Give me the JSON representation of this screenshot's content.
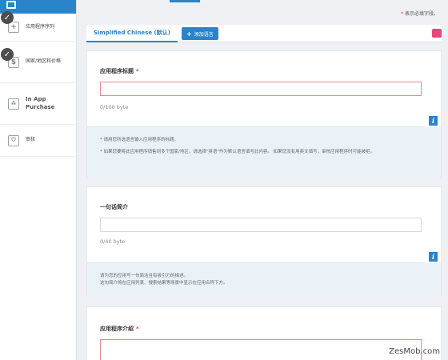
{
  "sidebar": {
    "items": [
      {
        "label": "应用程序序列",
        "icon": "plus-icon",
        "completed": true
      },
      {
        "label": "国家/地区和价格",
        "icon": "dollar-icon",
        "completed": true
      },
      {
        "label": "In App Purchase",
        "icon": "in-app-purchase-icon",
        "completed": false
      },
      {
        "label": "审核",
        "icon": "shield-icon",
        "completed": false
      }
    ]
  },
  "required_note": {
    "star": "*",
    "text": "表示必填字段。"
  },
  "lang_bar": {
    "active_tab": "Simplified Chinese (默认)",
    "add_button": "添加语言"
  },
  "cards": {
    "title_card": {
      "title": "应用程序标题",
      "required": "*",
      "counter": "0/100 byte",
      "help": [
        "* 请用您所选语言输入应用程序的标题。",
        "* 如果您要将此应用程序销售到多个国家/地区，请选择\"英语\"作为默认语言填写此内容。 如果您没有用英文填写，审核应用程序时可能被拒。"
      ]
    },
    "summary_card": {
      "title": "一句话简介",
      "counter": "0/40 byte",
      "help": [
        "请为您的应用写一句简洁且有吸引力的描述。",
        "这句简介将在应用列表、搜索结果等场景中显示在应用名称下方。"
      ]
    },
    "desc_card": {
      "title": "应用程序介绍",
      "required": "*"
    }
  },
  "watermark": "ZesMob.com",
  "colors": {
    "accent": "#2b84c9",
    "required": "#e33333",
    "error_border": "#e88a8a",
    "help_bg": "#eaf2f8"
  }
}
